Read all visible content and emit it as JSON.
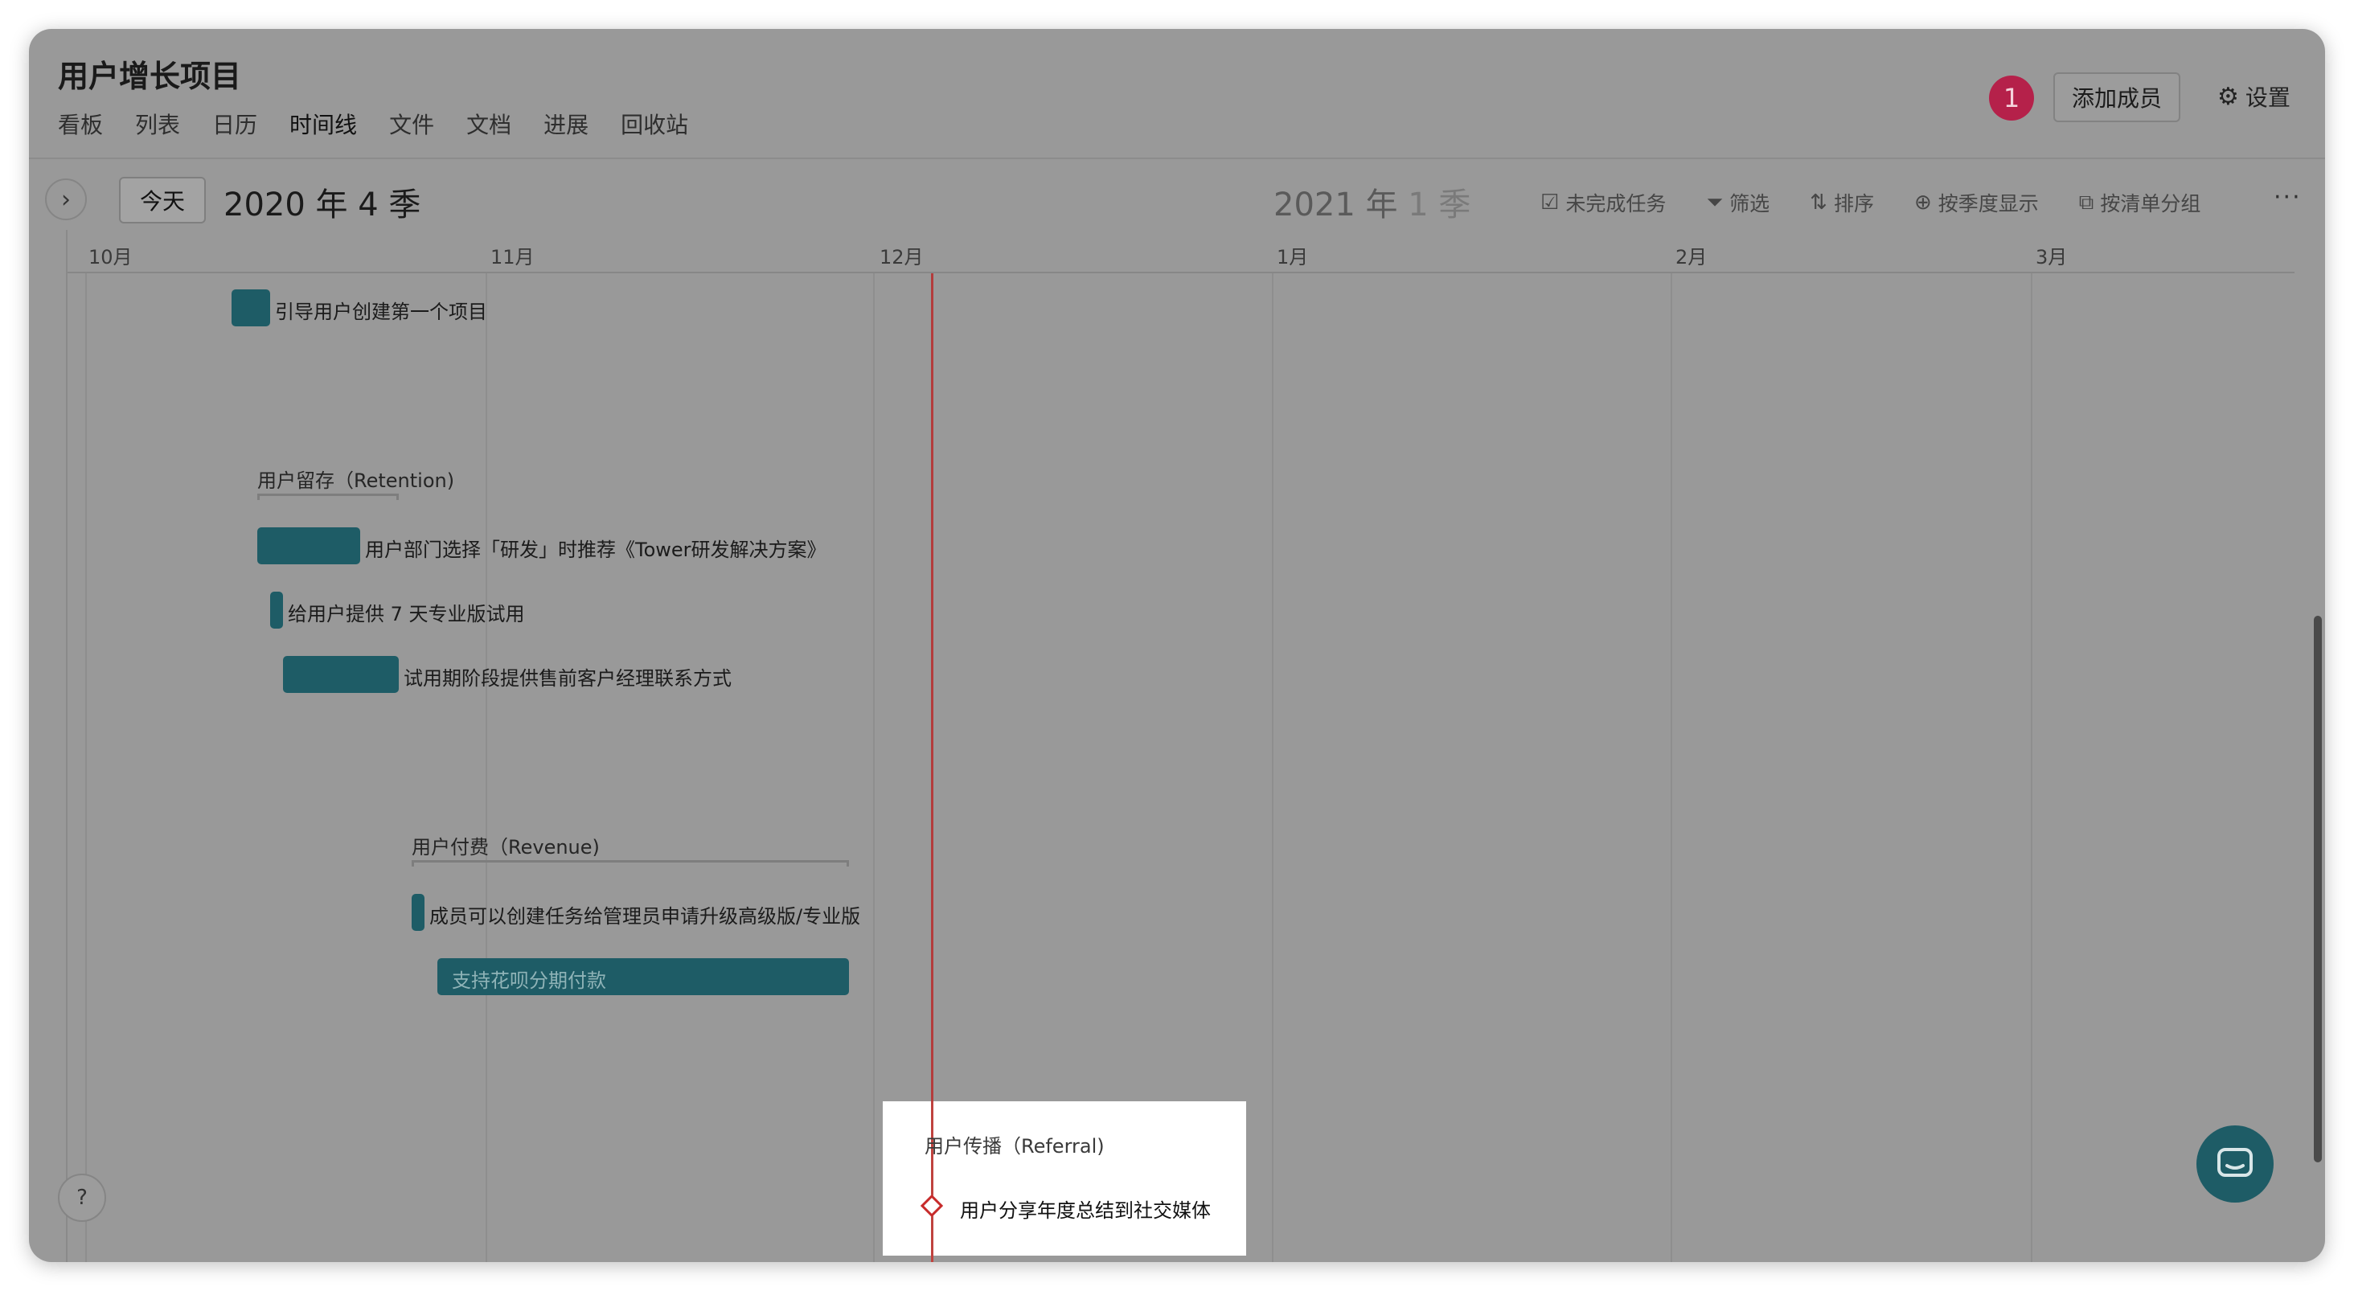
{
  "project": {
    "title": "用户增长项目"
  },
  "nav": {
    "tabs": [
      {
        "label": "看板"
      },
      {
        "label": "列表"
      },
      {
        "label": "日历"
      },
      {
        "label": "时间线"
      },
      {
        "label": "文件"
      },
      {
        "label": "文档"
      },
      {
        "label": "进展"
      },
      {
        "label": "回收站"
      }
    ],
    "active": "时间线"
  },
  "header": {
    "notification_count": "1",
    "add_member_label": "添加成员",
    "settings_label": "设置"
  },
  "toolbar": {
    "today_label": "今天",
    "current_quarter": "2020 年 4 季",
    "next_quarter_prefix": "2021 年",
    "next_quarter_num": "1",
    "next_quarter_suffix": "季",
    "tools": [
      {
        "label": "未完成任务",
        "icon": "checkbox-icon"
      },
      {
        "label": "筛选",
        "icon": "filter-icon"
      },
      {
        "label": "排序",
        "icon": "sort-icon"
      },
      {
        "label": "按季度显示",
        "icon": "zoom-icon"
      },
      {
        "label": "按清单分组",
        "icon": "group-icon"
      }
    ],
    "more_label": "···"
  },
  "timeline": {
    "months": [
      "10月",
      "11月",
      "12月",
      "1月",
      "2月",
      "3月"
    ],
    "tasks": [
      {
        "label": "引导用户创建第一个项目"
      },
      {
        "label": "用户部门选择「研发」时推荐《Tower研发解决方案》"
      },
      {
        "label": "给用户提供 7 天专业版试用"
      },
      {
        "label": "试用期阶段提供售前客户经理联系方式"
      },
      {
        "label": "成员可以创建任务给管理员申请升级高级版/专业版"
      },
      {
        "label": "支持花呗分期付款"
      }
    ],
    "groups": [
      {
        "title": "用户留存（Retention)"
      },
      {
        "title": "用户付费（Revenue)"
      },
      {
        "title": "用户传播（Referral)"
      }
    ],
    "milestone": {
      "label": "用户分享年度总结到社交媒体"
    }
  },
  "colors": {
    "bar": "#1e5c66",
    "today_line": "#c72b2b",
    "badge": "#b5214a"
  }
}
